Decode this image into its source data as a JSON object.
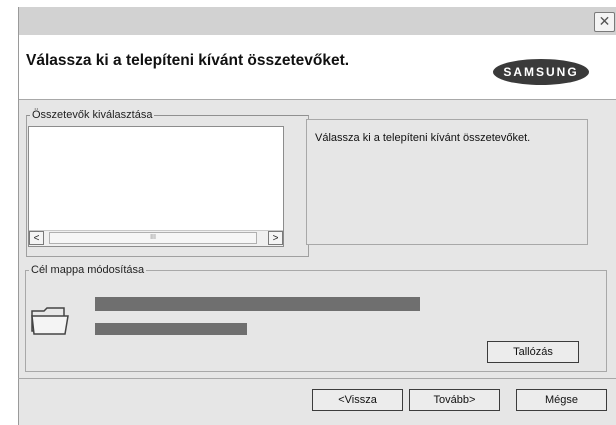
{
  "dialog": {
    "close_symbol": "✕",
    "heading": "Válassza ki a telepíteni kívánt összetevőket.",
    "brand": "SAMSUNG"
  },
  "components": {
    "legend": "Összetevők kiválasztása",
    "scroll_left": "<",
    "scroll_right": ">",
    "thumb_grip": "III",
    "description": "Válassza ki a telepíteni kívánt összetevőket."
  },
  "target_folder": {
    "legend": "Cél mappa módosítása",
    "browse_label": "Tallózás"
  },
  "footer": {
    "back_label": "<Vissza",
    "next_label": "Tovább>",
    "cancel_label": "Mégse"
  },
  "icons": [
    "close-icon",
    "folder-icon",
    "samsung-logo"
  ]
}
